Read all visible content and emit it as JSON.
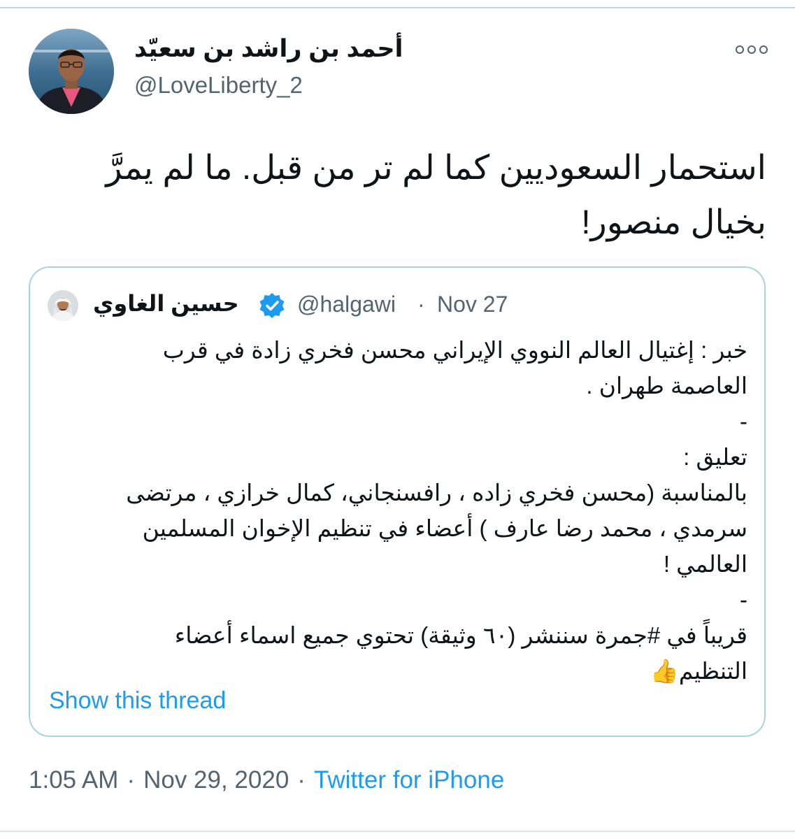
{
  "author": {
    "display_name": "أحمد بن راشد بن سعيّد",
    "username": "@LoveLiberty_2"
  },
  "tweet": {
    "text_lines": [
      "استحمار السعوديين كما لم تر من قبل. ما لم يمرَّ",
      "بخيال منصور!"
    ]
  },
  "quoted_tweet": {
    "display_name": "حسين الغاوي",
    "verified": true,
    "username": "@halgawi",
    "separator": "·",
    "date": "Nov 27",
    "body_lines": [
      "خبر : إغتيال العالم النووي الإيراني محسن فخري زادة في قرب",
      "العاصمة طهران .",
      "-",
      "تعليق :",
      "بالمناسبة (محسن فخري زاده ، رافسنجاني، كمال خرازي ، مرتضى",
      "سرمدي ، محمد رضا عارف ) أعضاء في تنظيم الإخوان المسلمين",
      "العالمي !",
      "-",
      "قريباً في #جمرة سننشر  (٦٠ وثيقة) تحتوي جميع اسماء أعضاء",
      "التنظيم"
    ],
    "emoji": "👍",
    "show_thread_label": "Show this thread"
  },
  "meta": {
    "time": "1:05 AM",
    "date": "Nov 29, 2020",
    "separator": "·",
    "source": "Twitter for iPhone"
  },
  "icons": {
    "more": "more-options-icon",
    "verified": "verified-badge-icon"
  },
  "colors": {
    "link_blue": "#1d9bf0",
    "secondary_text": "#536471",
    "card_border": "#a8d3e2",
    "verified_blue": "#1d9bf0"
  }
}
